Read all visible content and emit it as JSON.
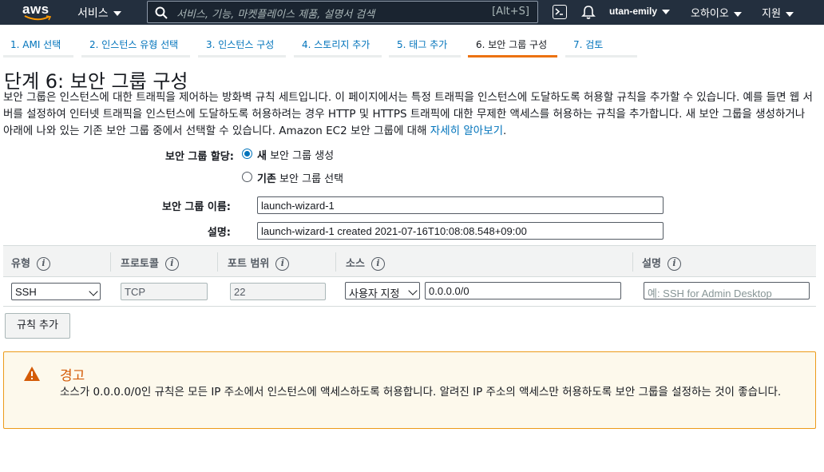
{
  "nav": {
    "logo_text": "aws",
    "services_label": "서비스",
    "search_placeholder": "서비스, 기능, 마켓플레이스 제품, 설명서 검색",
    "search_shortcut": "[Alt+S]",
    "user": "utan-emily",
    "region": "오하이오",
    "support": "지원"
  },
  "tabs": [
    {
      "label": "1. AMI 선택"
    },
    {
      "label": "2. 인스턴스 유형 선택"
    },
    {
      "label": "3. 인스턴스 구성"
    },
    {
      "label": "4. 스토리지 추가"
    },
    {
      "label": "5. 태그 추가"
    },
    {
      "label": "6. 보안 그룹 구성"
    },
    {
      "label": "7. 검토"
    }
  ],
  "page": {
    "title": "단계 6: 보안 그룹 구성",
    "intro": "보안 그룹은 인스턴스에 대한 트래픽을 제어하는 방화벽 규칙 세트입니다. 이 페이지에서는 특정 트래픽을 인스턴스에 도달하도록 허용할 규칙을 추가할 수 있습니다. 예를 들면 웹 서버를 설정하여 인터넷 트래픽을 인스턴스에 도달하도록 허용하려는 경우 HTTP 및 HTTPS 트래픽에 대한 무제한 액세스를 허용하는 규칙을 추가합니다. 새 보안 그룹을 생성하거나 아래에 나와 있는 기존 보안 그룹 중에서 선택할 수 있습니다. Amazon EC2 보안 그룹에 대해 ",
    "learn_more": "자세히 알아보기",
    "intro_end": "."
  },
  "form": {
    "assign_label": "보안 그룹 할당:",
    "radio_new_bold": "새",
    "radio_new_rest": " 보안 그룹 생성",
    "radio_existing_bold": "기존",
    "radio_existing_rest": " 보안 그룹 선택",
    "name_label": "보안 그룹 이름:",
    "name_value": "launch-wizard-1",
    "desc_label": "설명:",
    "desc_value": "launch-wizard-1 created 2021-07-16T10:08:08.548+09:00"
  },
  "rules": {
    "headers": {
      "type": "유형",
      "protocol": "프로토콜",
      "port": "포트 범위",
      "source": "소스",
      "description": "설명"
    },
    "info_glyph": "i",
    "rows": [
      {
        "type": "SSH",
        "protocol": "TCP",
        "port": "22",
        "source_type": "사용자 지정",
        "source_value": "0.0.0.0/0",
        "description_placeholder": "예: SSH for Admin Desktop"
      }
    ],
    "add_rule_label": "규칙 추가"
  },
  "warning": {
    "title": "경고",
    "body": "소스가 0.0.0.0/0인 규칙은 모든 IP 주소에서 인스턴스에 액세스하도록 허용합니다. 알려진 IP 주소의 액세스만 허용하도록 보안 그룹을 설정하는 것이 좋습니다."
  }
}
